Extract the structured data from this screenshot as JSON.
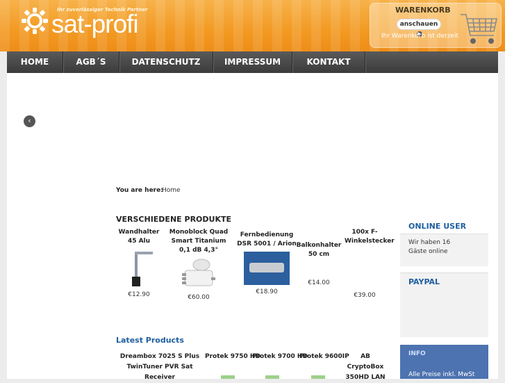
{
  "header": {
    "logo_text": "sat-profi",
    "tagline": "Ihr zuverlässiger Technik Partner",
    "cart": {
      "title": "WARENKORB",
      "button": "anschauen",
      "status": "Ihr Warenkorb ist derzeit leer."
    }
  },
  "nav": [
    "HOME",
    "AGB´S",
    "DATENSCHUTZ",
    "IMPRESSUM",
    "KONTAKT"
  ],
  "breadcrumb": {
    "label": "You are here:",
    "home": "Home"
  },
  "products": {
    "title": "VERSCHIEDENE PRODUKTE",
    "items": [
      {
        "name": "Wandhalter 45 Alu",
        "price": "€12.90"
      },
      {
        "name": "Monoblock Quad Smart Titanium 0,1 dB 4,3°",
        "price": "€60.00"
      },
      {
        "name": "Fernbedienung DSR 5001 / Arion",
        "price": "€18.90"
      },
      {
        "name": "Balkonhalter 50 cm",
        "price": "€14.00"
      },
      {
        "name": "100x F-Winkelstecker",
        "price": "€39.00"
      }
    ]
  },
  "latest": {
    "title": "Latest Products",
    "items": [
      "Dreambox 7025 S Plus TwinTuner PVR Sat Receiver",
      "Protek 9750 HD",
      "Protek 9700 HD",
      "Protek 9600IP",
      "AB CryptoBox 350HD LAN"
    ]
  },
  "sidebar": {
    "online_title": "ONLINE USER",
    "online_line1": "Wir haben 16",
    "online_line2": "Gäste online",
    "paypal_title": "PAYPAL",
    "info_title": "INFO",
    "info_text": "Alle Preise inkl. MwSt"
  },
  "colors": {
    "accent": "#f29a23",
    "nav": "#3b3b3b",
    "link": "#1f5fa0"
  }
}
